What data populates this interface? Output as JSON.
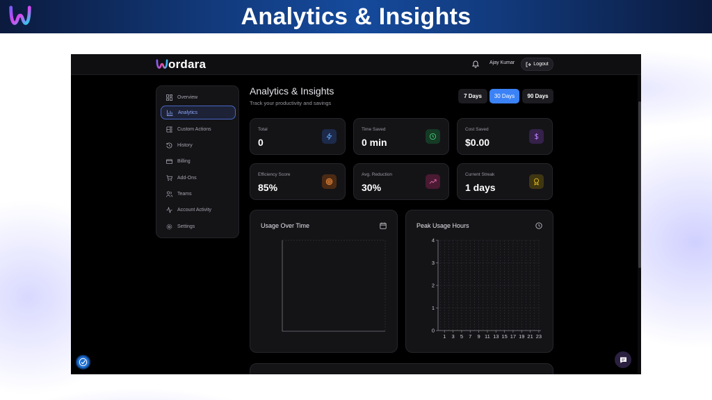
{
  "banner": {
    "title": "Analytics & Insights"
  },
  "app": {
    "brand": "ordara",
    "user_name": "Ajay Kumar",
    "logout_label": "Logout"
  },
  "sidebar": {
    "items": [
      {
        "label": "Overview",
        "icon": "grid-icon",
        "active": false
      },
      {
        "label": "Analytics",
        "icon": "bar-chart-icon",
        "active": true
      },
      {
        "label": "Custom Actions",
        "icon": "custom-actions-icon",
        "active": false
      },
      {
        "label": "History",
        "icon": "history-icon",
        "active": false
      },
      {
        "label": "Billing",
        "icon": "credit-card-icon",
        "active": false
      },
      {
        "label": "Add-Ons",
        "icon": "cart-icon",
        "active": false
      },
      {
        "label": "Teams",
        "icon": "users-icon",
        "active": false
      },
      {
        "label": "Account Activity",
        "icon": "activity-icon",
        "active": false
      },
      {
        "label": "Settings",
        "icon": "gear-icon",
        "active": false
      }
    ]
  },
  "main": {
    "title": "Analytics & Insights",
    "subtitle": "Track your productivity and savings",
    "ranges": [
      {
        "label": "7 Days",
        "active": false
      },
      {
        "label": "30 Days",
        "active": true
      },
      {
        "label": "90 Days",
        "active": false
      }
    ],
    "stats": [
      {
        "label": "Total",
        "value": "0",
        "icon": "lightning-icon",
        "color": "#60a5fa"
      },
      {
        "label": "Time Saved",
        "value": "0 min",
        "icon": "clock-icon",
        "color": "#4ade80"
      },
      {
        "label": "Cost Saved",
        "value": "$0.00",
        "icon": "dollar-icon",
        "color": "#c084fc"
      },
      {
        "label": "Efficiency Score",
        "value": "85%",
        "icon": "target-icon",
        "color": "#fb923c"
      },
      {
        "label": "Avg. Reduction",
        "value": "30%",
        "icon": "trending-up-icon",
        "color": "#f472b6"
      },
      {
        "label": "Current Streak",
        "value": "1 days",
        "icon": "award-icon",
        "color": "#facc15"
      }
    ],
    "usage_chart": {
      "title": "Usage Over Time",
      "icon": "calendar-icon"
    },
    "peak_chart": {
      "title": "Peak Usage Hours",
      "icon": "clock-icon"
    }
  },
  "chart_data": [
    {
      "type": "line",
      "title": "Usage Over Time",
      "x": [],
      "series": [],
      "grid": true
    },
    {
      "type": "bar",
      "title": "Peak Usage Hours",
      "categories": [
        "1",
        "3",
        "5",
        "7",
        "9",
        "11",
        "13",
        "15",
        "17",
        "19",
        "21",
        "23"
      ],
      "x_all": [
        0,
        1,
        2,
        3,
        4,
        5,
        6,
        7,
        8,
        9,
        10,
        11,
        12,
        13,
        14,
        15,
        16,
        17,
        18,
        19,
        20,
        21,
        22,
        23
      ],
      "yticks": [
        0,
        1,
        2,
        3,
        4
      ],
      "ylim": [
        0,
        4
      ],
      "series": [],
      "grid": true
    }
  ]
}
